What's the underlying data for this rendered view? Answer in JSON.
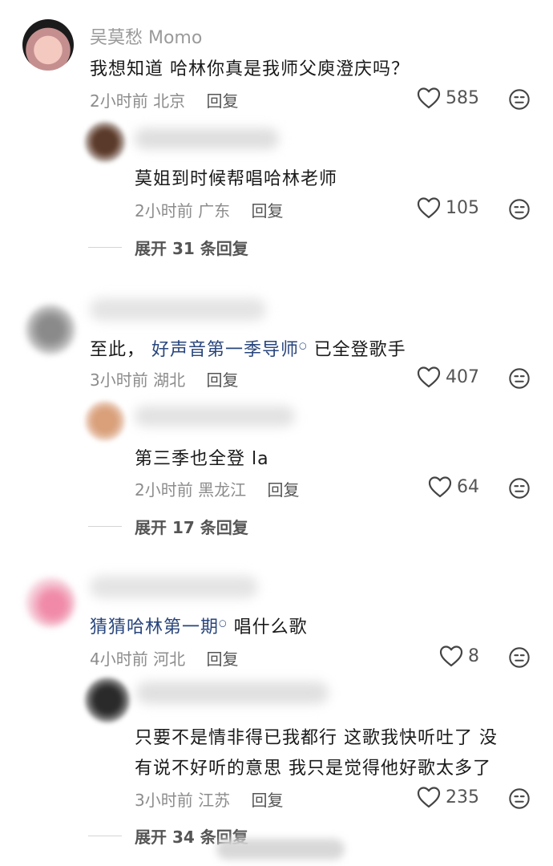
{
  "comments": [
    {
      "author": "吴莫愁 Momo",
      "text": "我想知道 哈林你真是我师父庾澄庆吗？",
      "time": "2小时前",
      "location": "北京",
      "reply_label": "回复",
      "likes": "585",
      "replies": [
        {
          "text": "莫姐到时候帮唱哈林老师",
          "time": "2小时前",
          "location": "广东",
          "reply_label": "回复",
          "likes": "105"
        }
      ],
      "expand_label": "展开 31 条回复"
    },
    {
      "text_prefix": "至此，",
      "text_link": "好声音第一季导师",
      "text_suffix": "已全登歌手",
      "time": "3小时前",
      "location": "湖北",
      "reply_label": "回复",
      "likes": "407",
      "replies": [
        {
          "text": "第三季也全登 la",
          "time": "2小时前",
          "location": "黑龙江",
          "reply_label": "回复",
          "likes": "64"
        }
      ],
      "expand_label": "展开 17 条回复"
    },
    {
      "text_link": "猜猜哈林第一期",
      "text_suffix": "唱什么歌",
      "time": "4小时前",
      "location": "河北",
      "reply_label": "回复",
      "likes": "8",
      "replies": [
        {
          "text_line1": "只要不是情非得已我都行 这歌我快听吐了 没",
          "text_line2": "有说不好听的意思 我只是觉得他好歌太多了",
          "time": "3小时前",
          "location": "江苏",
          "reply_label": "回复",
          "likes": "235"
        }
      ],
      "expand_label": "展开 34 条回复"
    }
  ],
  "icons": {
    "heart": "heart-outline-icon",
    "dislike": "meh-face-icon",
    "search": "search-icon"
  },
  "colors": {
    "link": "#28457c",
    "meta": "#8c8c8c",
    "text": "#1a1a1a"
  }
}
